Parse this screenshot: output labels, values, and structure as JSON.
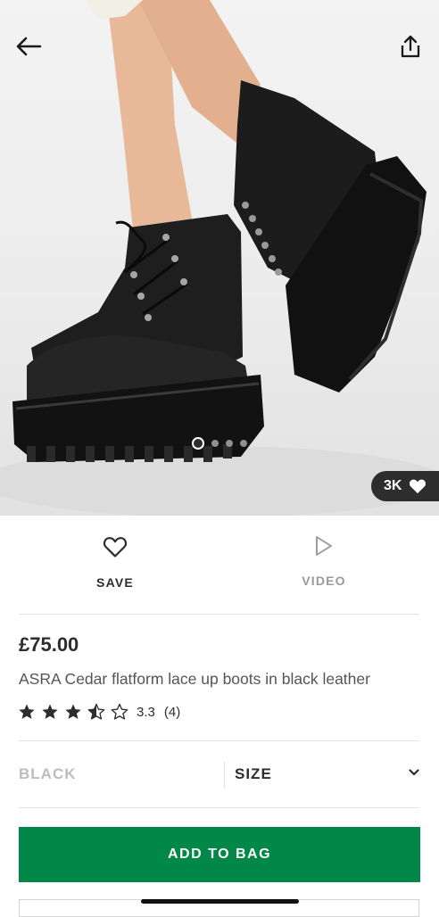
{
  "product": {
    "image_alt": "Black leather lace-up platform boots",
    "carousel": {
      "total": 4,
      "active_index": 0
    },
    "likes": "3K",
    "price": "£75.00",
    "title": "ASRA Cedar flatform lace up boots in black leather",
    "rating": {
      "score": "3.3",
      "count": "(4)",
      "stars_value": 3.5,
      "stars_max": 5
    }
  },
  "actions": {
    "save_label": "SAVE",
    "video_label": "VIDEO"
  },
  "selectors": {
    "colour_value": "BLACK",
    "size_label": "SIZE"
  },
  "cta": {
    "add_to_bag_label": "ADD TO BAG"
  },
  "icons": {
    "back": "arrow-left-icon",
    "share": "share-icon",
    "heart": "heart-icon",
    "play": "play-icon",
    "chevron": "chevron-down-icon",
    "star": "star-icon"
  },
  "colors": {
    "primary_text": "#2d2d2d",
    "muted_text": "#9a9a9a",
    "cta_green": "#018849",
    "badge_dark": "#2d2d2d"
  }
}
